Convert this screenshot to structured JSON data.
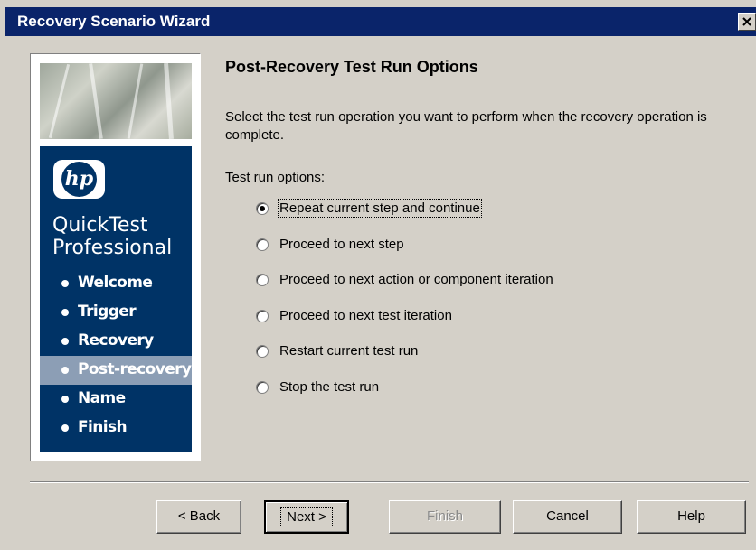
{
  "window": {
    "title": "Recovery Scenario Wizard"
  },
  "sidebar": {
    "logo_text": "hp",
    "product_line1": "QuickTest",
    "product_line2": "Professional",
    "steps": [
      {
        "label": "Welcome",
        "active": false
      },
      {
        "label": "Trigger",
        "active": false
      },
      {
        "label": "Recovery",
        "active": false
      },
      {
        "label": "Post-recovery",
        "active": true
      },
      {
        "label": "Name",
        "active": false
      },
      {
        "label": "Finish",
        "active": false
      }
    ]
  },
  "main": {
    "heading": "Post-Recovery Test Run Options",
    "description": "Select the test run operation you want to perform when the recovery operation is complete.",
    "options_label": "Test run options:",
    "options": [
      {
        "label": "Repeat current step and continue",
        "selected": true
      },
      {
        "label": "Proceed to next step",
        "selected": false
      },
      {
        "label": "Proceed to next action or component iteration",
        "selected": false
      },
      {
        "label": "Proceed to next test iteration",
        "selected": false
      },
      {
        "label": "Restart current test run",
        "selected": false
      },
      {
        "label": "Stop the test run",
        "selected": false
      }
    ]
  },
  "buttons": {
    "back": "< Back",
    "next": "Next >",
    "finish": "Finish",
    "cancel": "Cancel",
    "help": "Help"
  },
  "colors": {
    "titlebar": "#0a246a",
    "sidebar_bg": "#003366",
    "sidebar_active": "#8c9eb5",
    "dialog_bg": "#d4d0c8"
  }
}
